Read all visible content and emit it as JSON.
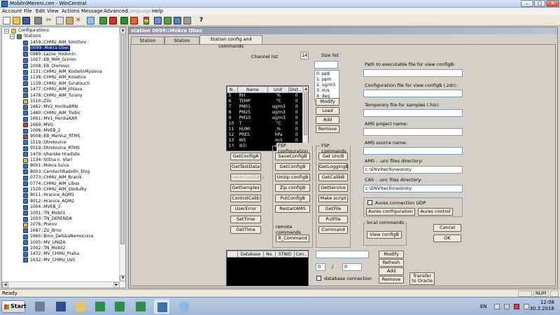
{
  "window": {
    "title": "MobilniMereni.cen - WinCentral",
    "min_label": "–",
    "max_label": "□",
    "close_label": "✕"
  },
  "menu": [
    "Account",
    "File",
    "Edit",
    "View",
    "Actions",
    "Message",
    "Advanced",
    "Language",
    "Help"
  ],
  "toolbar_icons": [
    "new-doc-icon",
    "open-folder-icon",
    "save-icon",
    "print-icon",
    "cut-icon",
    "copy-icon",
    "paste-icon",
    "delete-icon",
    "zoom-icon",
    "connect-icon",
    "disconnect-icon",
    "play-icon",
    "stop-icon",
    "traffic-light-icon",
    "config-icon",
    "grid-icon",
    "monitor-icon",
    "wrench-icon",
    "help-icon"
  ],
  "tree": {
    "root": "Configurations",
    "stations_label": "Stations",
    "items": [
      {
        "label": "1459::CHMU_AIM_Smichov",
        "color": "#2f6fd6"
      },
      {
        "label": "0099::Mokra Obec",
        "color": "#2f6fd6",
        "selected": true
      },
      {
        "label": "0980::Lazne_Hodonin",
        "color": "#2f6fd6"
      },
      {
        "label": "1007::EB_MIM_Grimm",
        "color": "#2f6fd6"
      },
      {
        "label": "1008::EB_Olomouc",
        "color": "#2f6fd6"
      },
      {
        "label": "1131::CHMU_AIM_KostelinMyslova",
        "color": "#2f6fd6"
      },
      {
        "label": "1138::CHMU_AIM_Kosetice",
        "color": "#2f6fd6"
      },
      {
        "label": "1139::CHMU_AIM_Svratouch",
        "color": "#2f6fd6"
      },
      {
        "label": "1477::CHMU_AIM_Jihlava",
        "color": "#2f6fd6"
      },
      {
        "label": "1478::CHMU_AIM_Turany",
        "color": "#2f6fd6"
      },
      {
        "label": "1510::Zlin",
        "color": "#d6c42f"
      },
      {
        "label": "1662::MV2_HoribaBRN",
        "color": "#2f6fd6"
      },
      {
        "label": "1480::CHMU_AIM_Trebic",
        "color": "#2f6fd6"
      },
      {
        "label": "1661::MV1_HoribaKAR",
        "color": "#2f6fd6"
      },
      {
        "label": "1669::MVG",
        "color": "#c93a2a"
      },
      {
        "label": "1006::MVEB_2",
        "color": "#2f6fd6"
      },
      {
        "label": "9008::EB_MerVuz_RTMS",
        "color": "#c93a2a"
      },
      {
        "label": "1519::Otrokovice",
        "color": "#2f6fd6"
      },
      {
        "label": "9519::Otrokovice_RTMS",
        "color": "#2f6fd6"
      },
      {
        "label": "1479::Uherske Hradiste",
        "color": "#2f6fd6"
      },
      {
        "label": "1134::Stitna n. Vlari",
        "color": "#d6c42f"
      },
      {
        "label": "8001::Mokra Svice",
        "color": "#2f6fd6"
      },
      {
        "label": "8003::CemtechRadotin_Elog",
        "color": "#2f6fd6"
      },
      {
        "label": "0773::CHMU_AIM_Branik",
        "color": "#2f6fd6"
      },
      {
        "label": "0774::CHMU_AIM_Libus",
        "color": "#2f6fd6"
      },
      {
        "label": "1520::CHMU_AIM_Stodulky",
        "color": "#2f6fd6"
      },
      {
        "label": "8011::Hranice_AQM1",
        "color": "#2f6fd6"
      },
      {
        "label": "8012::Hranice_AQM2",
        "color": "#2f6fd6"
      },
      {
        "label": "1004::MVEB_3",
        "color": "#2f6fd6"
      },
      {
        "label": "1001::TN_Mobil1",
        "color": "#2f6fd6"
      },
      {
        "label": "1003::TN_DERENDA",
        "color": "#2f6fd6"
      },
      {
        "label": "1076::Prerov",
        "color": "#d6c42f"
      },
      {
        "label": "1687::ZU_Brno",
        "color": "#2f6fd6"
      },
      {
        "label": "1960::Brno_DetskaNemocnice",
        "color": "#2f6fd6"
      },
      {
        "label": "1005::MV_UNIZA",
        "color": "#2f6fd6"
      },
      {
        "label": "1002::TN_Mobil2",
        "color": "#2f6fd6"
      },
      {
        "label": "1472::MV_CHMU_Praha",
        "color": "#2f6fd6"
      },
      {
        "label": "1632::MV_CHMU_Usti",
        "color": "#2f6fd6"
      }
    ]
  },
  "child": {
    "title": "station 0099::Mokra Obec",
    "tabs": [
      "Station setting",
      "Station logging",
      "Station config and commands"
    ],
    "channel_list": {
      "label": "Channel list",
      "count": "14",
      "headers": [
        "N..",
        "Name",
        "Unit",
        "Dist..."
      ],
      "rows": [
        [
          "5",
          "RH",
          "%",
          "0"
        ],
        [
          "6",
          "TEMP",
          "°C",
          "0"
        ],
        [
          "7",
          "PM01",
          "ug/m3",
          "0"
        ],
        [
          "8",
          "PM25",
          "ug/m3",
          "0"
        ],
        [
          "9",
          "PM10",
          "ug/m3",
          "0"
        ],
        [
          "10",
          "T",
          "°C",
          "0"
        ],
        [
          "11",
          "HUMI",
          "%",
          "0"
        ],
        [
          "12",
          "PRES",
          "hPa",
          "0"
        ],
        [
          "13",
          "WS",
          "m/s",
          "0"
        ],
        [
          "14",
          "WD",
          "deg",
          "0"
        ]
      ]
    },
    "size_list": {
      "label": "Size list",
      "items": [
        "0:  ppb",
        "1:  ppm",
        "2:  ug/m3",
        "3:  m/s",
        "4:  deg"
      ],
      "buttons": [
        "Modify",
        "Load",
        "Add",
        "Remove"
      ]
    },
    "ams_commands": {
      "title": "AMS commands",
      "buttons": [
        "GetConfigA",
        "GetTestData",
        "GetActualData",
        "GetSamples",
        "ControlCalib",
        "UserError",
        "SetTime",
        "GetTime"
      ]
    },
    "fsp_configuration": {
      "title": "FSP configuration",
      "buttons": [
        "SaveConfigB",
        "GetConfigB",
        "Unzip configB",
        "Zip configB",
        "PutConfigB",
        "RestartAMS"
      ]
    },
    "fsp_commands": {
      "title": "FSP commands",
      "buttons": [
        "Get UncB",
        "GetLoggingB",
        "GetCalibB",
        "GetService",
        "Make script",
        "GetFile",
        "PutFile",
        "Command"
      ]
    },
    "remote_commands": {
      "title": "remote commands",
      "button": "R_Command"
    },
    "right_fields": [
      {
        "label": "Path to executable file for view configB:",
        "value": ""
      },
      {
        "label": "Configuration file for view configB (.zdr):",
        "value": ""
      },
      {
        "label": "Temporary file for samples (.his):",
        "value": ""
      },
      {
        "label": "AMS project name:",
        "value": ""
      },
      {
        "label": "AMS source name:",
        "value": ""
      },
      {
        "label": "AMS - .unc files directory:",
        "value": "c:\\ENVItech\\neistoty"
      },
      {
        "label": "CAS - .unc files directory:",
        "value": "c:\\ENVItech\\neistoty"
      }
    ],
    "aures": {
      "checkbox_label": "Aures connection UDP",
      "config_button": "Aures configuration",
      "control_button": "Aures control"
    },
    "local_commands": {
      "title": "local commands",
      "button": "View configB"
    },
    "cancel_label": "Cancel",
    "ok_label": "OK",
    "database": {
      "headers": [
        "Database",
        "No.",
        "STNID",
        "Con..."
      ],
      "input_value": "",
      "num1": "0",
      "slash": "/",
      "num2": "0",
      "checkbox_label": "database connection",
      "buttons": [
        "Modify",
        "Refresh",
        "Add",
        "Remove"
      ],
      "transfer_label": "Transfer to Oracle"
    }
  },
  "status": {
    "text": "Ready",
    "num": "NUM"
  },
  "taskbar": {
    "start_label": "Start",
    "lang": "EN",
    "time": "12:08",
    "date": "30.3.2016"
  }
}
